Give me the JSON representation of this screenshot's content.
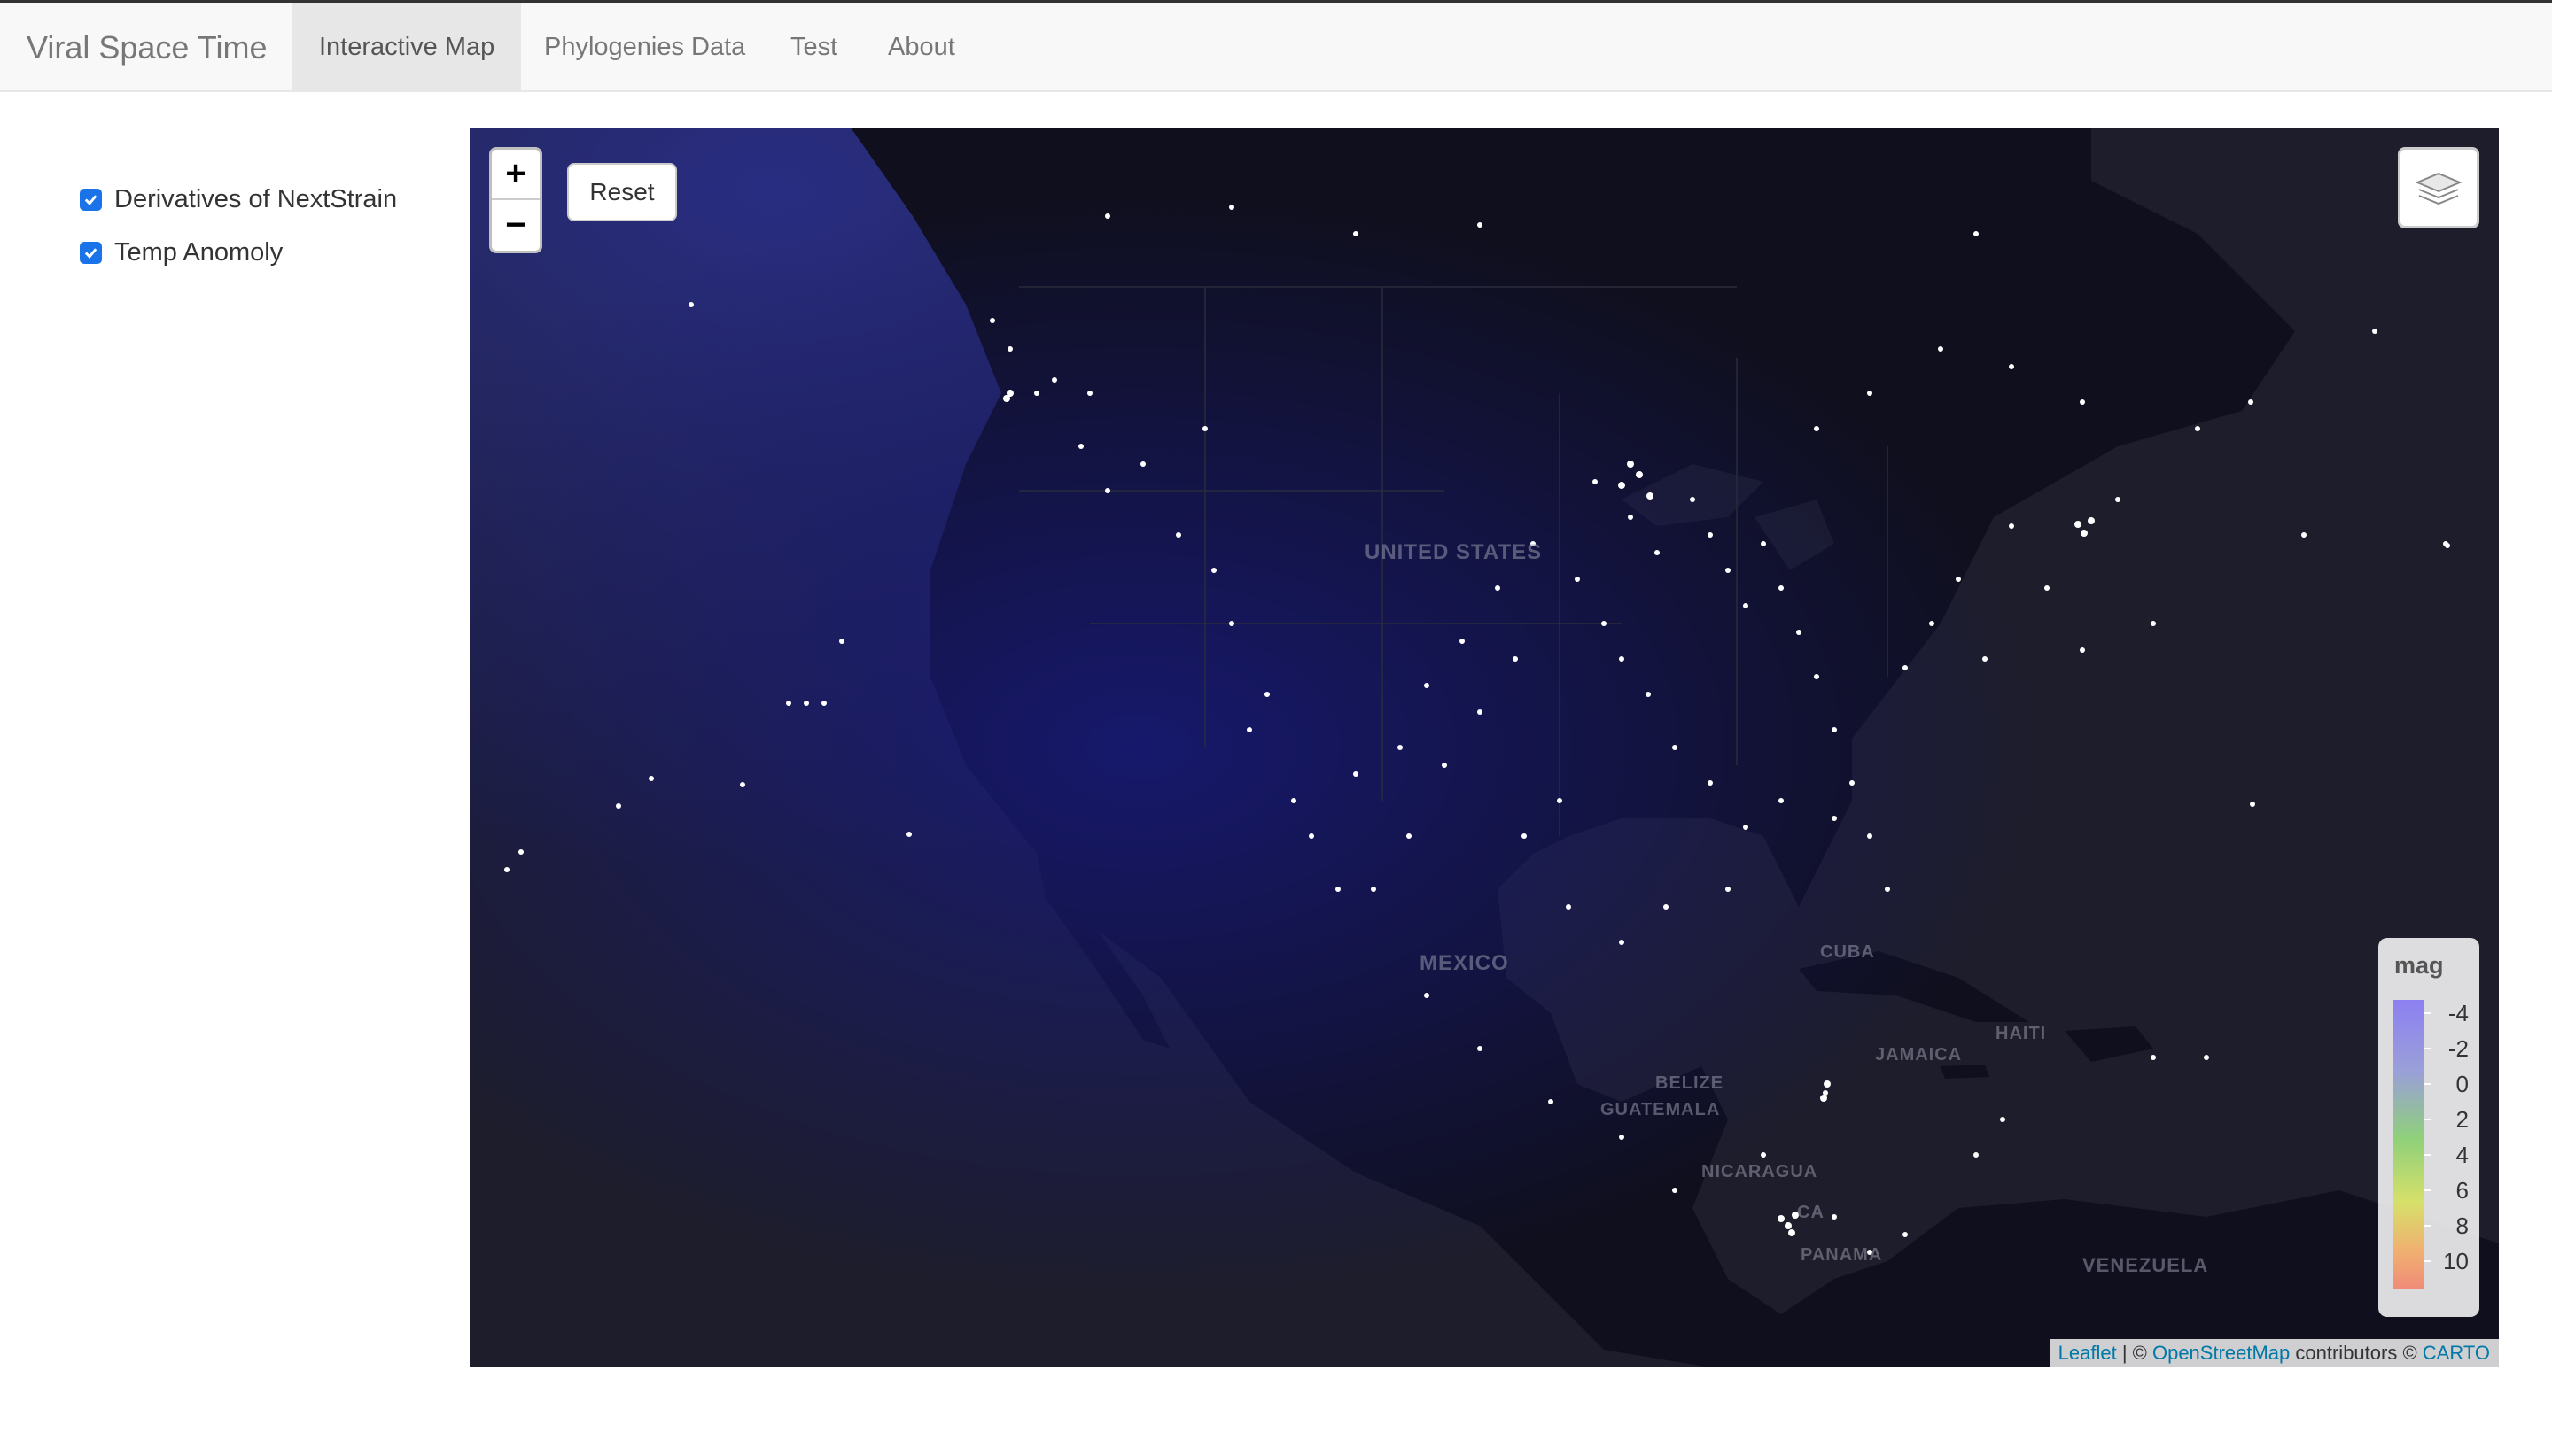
{
  "navbar": {
    "brand": "Viral Space Time",
    "tabs": [
      {
        "label": "Interactive Map",
        "active": true
      },
      {
        "label": "Phylogenies Data",
        "active": false
      },
      {
        "label": "Test",
        "active": false
      },
      {
        "label": "About",
        "active": false
      }
    ]
  },
  "sidebar": {
    "layers": [
      {
        "label": "Derivatives of NextStrain",
        "checked": true
      },
      {
        "label": "Temp Anomoly",
        "checked": true
      }
    ]
  },
  "map": {
    "zoom_in": "+",
    "zoom_out": "−",
    "reset_label": "Reset",
    "layers_icon": "layers-icon",
    "labels": {
      "us": "UNITED STATES",
      "mexico": "MEXICO",
      "cuba": "CUBA",
      "jamaica": "JAMAICA",
      "haiti": "HAITI",
      "belize": "BELIZE",
      "guatemala": "GUATEMALA",
      "nicaragua": "NICARAGUA",
      "panama": "PANAMA",
      "venezuela": "VENEZUELA",
      "costa_rica": "CA"
    },
    "legend": {
      "title": "mag",
      "ticks": [
        "-4",
        "-2",
        "0",
        "2",
        "4",
        "6",
        "8",
        "10"
      ],
      "colors": [
        "#8d80f2",
        "#9aa0d8",
        "#8fd07a",
        "#d6e06a",
        "#f0b070",
        "#f08c78"
      ]
    },
    "attribution": {
      "leaflet": "Leaflet",
      "sep": " | © ",
      "osm": "OpenStreetMap",
      "contrib": " contributors © ",
      "carto": "CARTO"
    }
  }
}
